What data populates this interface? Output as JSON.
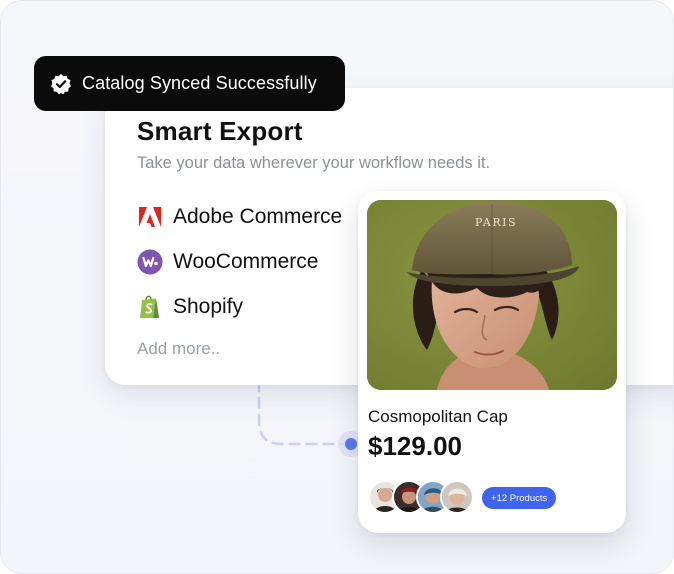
{
  "toast": {
    "text": "Catalog Synced Successfully",
    "icon": "verified-badge-icon"
  },
  "export_card": {
    "title": "Smart Export",
    "subtitle": "Take your data wherever your workflow needs it.",
    "platforms": [
      {
        "label": "Adobe Commerce",
        "icon": "adobe-icon",
        "color": "#e0241b"
      },
      {
        "label": "WooCommerce",
        "icon": "woocommerce-icon",
        "color": "#7f54b3"
      },
      {
        "label": "Shopify",
        "icon": "shopify-icon",
        "color": "#95bf47"
      }
    ],
    "add_more": "Add more.."
  },
  "product": {
    "name": "Cosmopolitan Cap",
    "price": "$129.00",
    "image_alt": "Person wearing olive green cap",
    "cap_text": "PARIS",
    "more_products": "+12 Products"
  },
  "colors": {
    "accent": "#3e64f0",
    "connector": "#c9cff5"
  }
}
